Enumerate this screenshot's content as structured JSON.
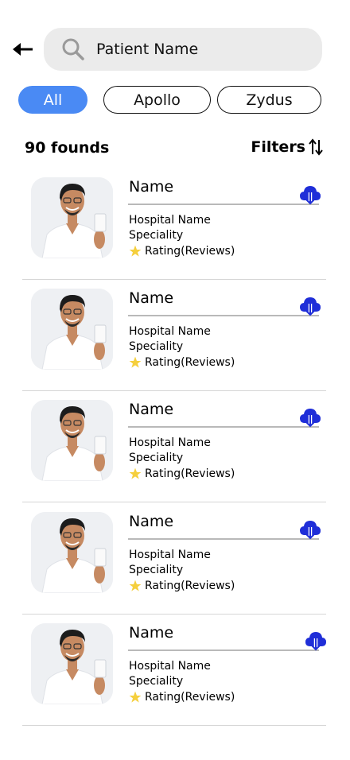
{
  "search": {
    "placeholder": "Patient Name"
  },
  "chips": [
    "All",
    "Apollo",
    "Zydus"
  ],
  "results": {
    "count_label": "90 founds",
    "filters_label": "Filters"
  },
  "doctors": [
    {
      "name": "Name",
      "hospital": "Hospital Name",
      "speciality": "Speciality",
      "rating": "Rating(Reviews)"
    },
    {
      "name": "Name",
      "hospital": "Hospital Name",
      "speciality": "Speciality",
      "rating": "Rating(Reviews)"
    },
    {
      "name": "Name",
      "hospital": "Hospital Name",
      "speciality": "Speciality",
      "rating": "Rating(Reviews)"
    },
    {
      "name": "Name",
      "hospital": "Hospital Name",
      "speciality": "Speciality",
      "rating": "Rating(Reviews)"
    },
    {
      "name": "Name",
      "hospital": "Hospital Name",
      "speciality": "Speciality",
      "rating": "Rating(Reviews)"
    }
  ],
  "colors": {
    "accent": "#4a8af4",
    "cloud": "#1f2ed8",
    "star": "#f5cf3d",
    "search_bg": "#ebebeb"
  },
  "icons": [
    "back-arrow-icon",
    "search-icon",
    "sort-icon",
    "cloud-download-icon",
    "star-icon",
    "doctor-photo"
  ]
}
